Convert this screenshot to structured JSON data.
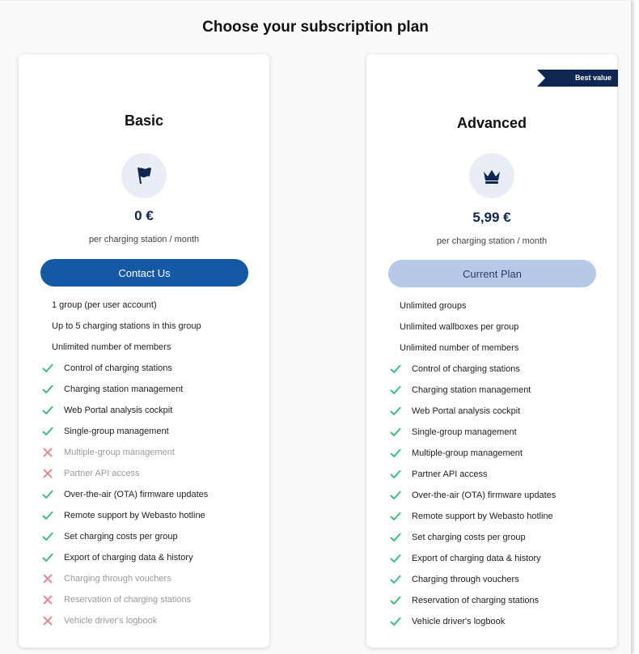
{
  "page": {
    "title": "Choose your subscription plan"
  },
  "colors": {
    "check": "#3fbf7f",
    "cross": "#e68a93",
    "primary": "#1559a6",
    "navy": "#0d2750",
    "current": "#b7c9e8"
  },
  "plans": [
    {
      "id": "basic",
      "name": "Basic",
      "icon": "flag-icon",
      "price": "0 €",
      "price_unit": "per charging station / month",
      "button": "Contact Us",
      "button_state": "primary",
      "features": [
        {
          "label": "1 group (per user account)",
          "status": "plain"
        },
        {
          "label": "Up to 5 charging stations in this group",
          "status": "plain"
        },
        {
          "label": "Unlimited number of members",
          "status": "plain"
        },
        {
          "label": "Control of charging stations",
          "status": "included"
        },
        {
          "label": "Charging station management",
          "status": "included"
        },
        {
          "label": "Web Portal analysis cockpit",
          "status": "included"
        },
        {
          "label": "Single-group management",
          "status": "included"
        },
        {
          "label": "Multiple-group management",
          "status": "excluded"
        },
        {
          "label": "Partner API access",
          "status": "excluded"
        },
        {
          "label": "Over-the-air (OTA) firmware updates",
          "status": "included"
        },
        {
          "label": "Remote support by Webasto hotline",
          "status": "included"
        },
        {
          "label": "Set charging costs per group",
          "status": "included"
        },
        {
          "label": "Export of charging data & history",
          "status": "included"
        },
        {
          "label": "Charging through vouchers",
          "status": "excluded"
        },
        {
          "label": "Reservation of charging stations",
          "status": "excluded"
        },
        {
          "label": "Vehicle driver's logbook",
          "status": "excluded"
        }
      ]
    },
    {
      "id": "advanced",
      "name": "Advanced",
      "badge": "Best value",
      "icon": "crown-icon",
      "price": "5,99 €",
      "price_unit": "per charging station / month",
      "button": "Current Plan",
      "button_state": "current",
      "features": [
        {
          "label": "Unlimited groups",
          "status": "plain"
        },
        {
          "label": "Unlimited wallboxes per group",
          "status": "plain"
        },
        {
          "label": "Unlimited number of members",
          "status": "plain"
        },
        {
          "label": "Control of charging stations",
          "status": "included"
        },
        {
          "label": "Charging station management",
          "status": "included"
        },
        {
          "label": "Web Portal analysis cockpit",
          "status": "included"
        },
        {
          "label": "Single-group management",
          "status": "included"
        },
        {
          "label": "Multiple-group management",
          "status": "included"
        },
        {
          "label": "Partner API access",
          "status": "included"
        },
        {
          "label": "Over-the-air (OTA) firmware updates",
          "status": "included"
        },
        {
          "label": "Remote support by Webasto hotline",
          "status": "included"
        },
        {
          "label": "Set charging costs per group",
          "status": "included"
        },
        {
          "label": "Export of charging data & history",
          "status": "included"
        },
        {
          "label": "Charging through vouchers",
          "status": "included"
        },
        {
          "label": "Reservation of charging stations",
          "status": "included"
        },
        {
          "label": "Vehicle driver's logbook",
          "status": "included"
        }
      ]
    }
  ]
}
